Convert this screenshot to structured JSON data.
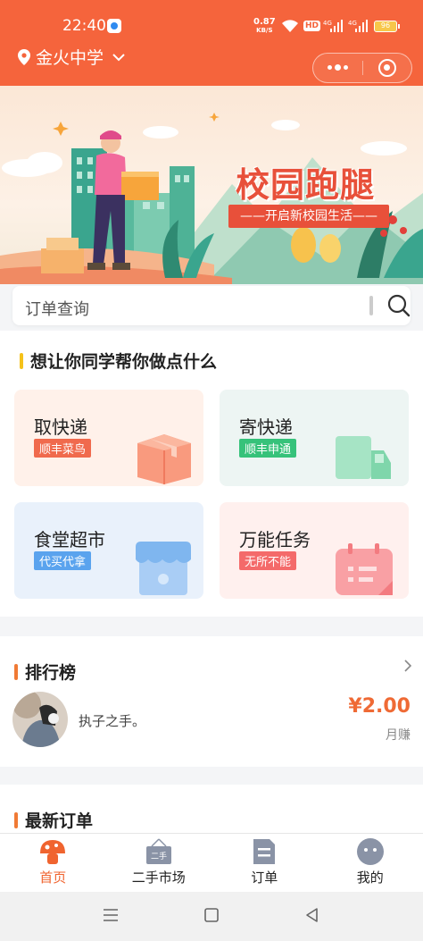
{
  "status_bar": {
    "time": "22:40",
    "speed_value": "0.87",
    "speed_unit": "KB/S",
    "hd": "HD",
    "network_1": "4G",
    "network_2": "4G",
    "battery": "96"
  },
  "header": {
    "location": "金火中学",
    "menu_icon": "more-dots-icon",
    "close_icon": "target-icon"
  },
  "banner": {
    "title": "校园跑腿",
    "subtitle": "——开启新校园生活——"
  },
  "search": {
    "placeholder": "订单查询"
  },
  "services_section": {
    "title": "想让你同学帮你做点什么",
    "accent": "#f5c21a"
  },
  "services": [
    {
      "name": "取快递",
      "tag": "顺丰菜鸟",
      "tag_color": "#f06a4d",
      "bg": "#fff1ea",
      "icon": "package-box-icon"
    },
    {
      "name": "寄快递",
      "tag": "顺丰申通",
      "tag_color": "#36c27a",
      "bg": "#edf5f3",
      "icon": "delivery-truck-icon"
    },
    {
      "name": "食堂超市",
      "tag": "代买代拿",
      "tag_color": "#5aa3ee",
      "bg": "#e9f1fb",
      "icon": "store-icon"
    },
    {
      "name": "万能任务",
      "tag": "无所不能",
      "tag_color": "#f46a6a",
      "bg": "#fff0ee",
      "icon": "calendar-task-icon"
    }
  ],
  "ranking": {
    "title": "排行榜",
    "accent": "#f07a35",
    "entries": [
      {
        "nickname": "执子之手。",
        "amount": "¥2.00",
        "amount_label": "月赚"
      }
    ]
  },
  "orders": {
    "title": "最新订单"
  },
  "tabbar": [
    {
      "label": "首页",
      "icon": "home-mushroom-icon",
      "active": true
    },
    {
      "label": "二手市场",
      "icon": "second-hand-sign-icon",
      "sign_text": "二手",
      "active": false
    },
    {
      "label": "订单",
      "icon": "document-icon",
      "active": false
    },
    {
      "label": "我的",
      "icon": "user-face-icon",
      "active": false
    }
  ]
}
